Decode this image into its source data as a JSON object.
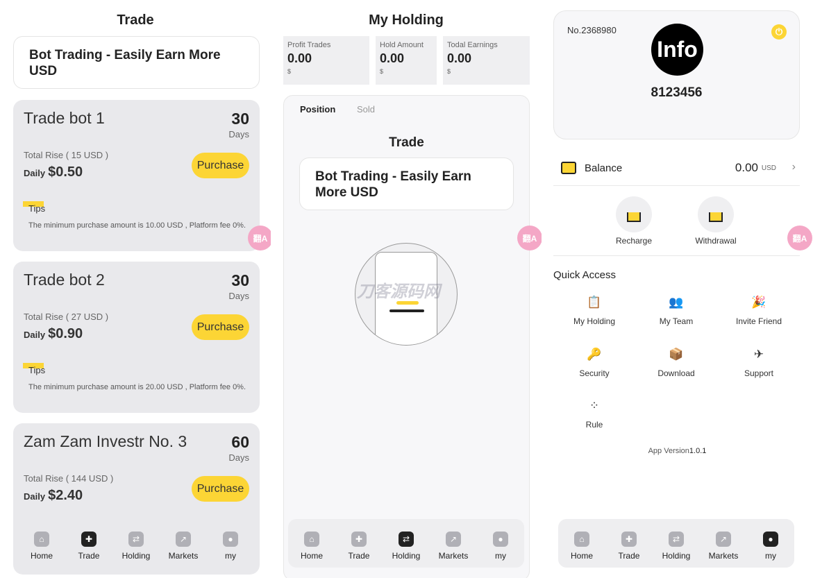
{
  "trade": {
    "title": "Trade",
    "banner": "Bot Trading - Easily Earn More USD",
    "cards": [
      {
        "name": "Trade bot 1",
        "days": "30",
        "days_label": "Days",
        "rise": "Total Rise ( 15 USD )",
        "daily_label": "Daily",
        "daily": "$0.50",
        "buy": "Purchase",
        "tips": "Tips",
        "tip_text": "The minimum purchase amount is 10.00 USD , Platform fee 0%."
      },
      {
        "name": "Trade bot 2",
        "days": "30",
        "days_label": "Days",
        "rise": "Total Rise ( 27 USD )",
        "daily_label": "Daily",
        "daily": "$0.90",
        "buy": "Purchase",
        "tips": "Tips",
        "tip_text": "The minimum purchase amount is 20.00 USD , Platform fee 0%."
      },
      {
        "name": "Zam Zam Investr No. 3",
        "days": "60",
        "days_label": "Days",
        "rise": "Total Rise ( 144 USD )",
        "daily_label": "Daily",
        "daily": "$2.40",
        "buy": "Purchase"
      }
    ]
  },
  "holding": {
    "title": "My Holding",
    "stats": [
      {
        "label": "Profit Trades",
        "value": "0.00",
        "unit": "$"
      },
      {
        "label": "Hold Amount",
        "value": "0.00",
        "unit": "$"
      },
      {
        "label": "Todal Earnings",
        "value": "0.00",
        "unit": "$"
      }
    ],
    "tabs": [
      "Position",
      "Sold"
    ],
    "inner_title": "Trade",
    "inner_banner": "Bot Trading - Easily Earn More USD",
    "watermark": "刀客源码网"
  },
  "profile": {
    "user_no": "No.2368980",
    "avatar_text": "Info",
    "user_id": "8123456",
    "balance_label": "Balance",
    "balance_value": "0.00",
    "balance_unit": "USD",
    "recharge": "Recharge",
    "withdrawal": "Withdrawal",
    "quick_access_title": "Quick Access",
    "quick_access": [
      "My Holding",
      "My Team",
      "Invite Friend",
      "Security",
      "Download",
      "Support",
      "Rule"
    ],
    "app_version_label": "App Version",
    "app_version": "1.0.1"
  },
  "nav": [
    "Home",
    "Trade",
    "Holding",
    "Markets",
    "my"
  ],
  "translate_badge": "翻A",
  "colors": {
    "accent": "#fcd535",
    "card_bg": "#e9e9ec",
    "float": "#f4a7c6"
  }
}
